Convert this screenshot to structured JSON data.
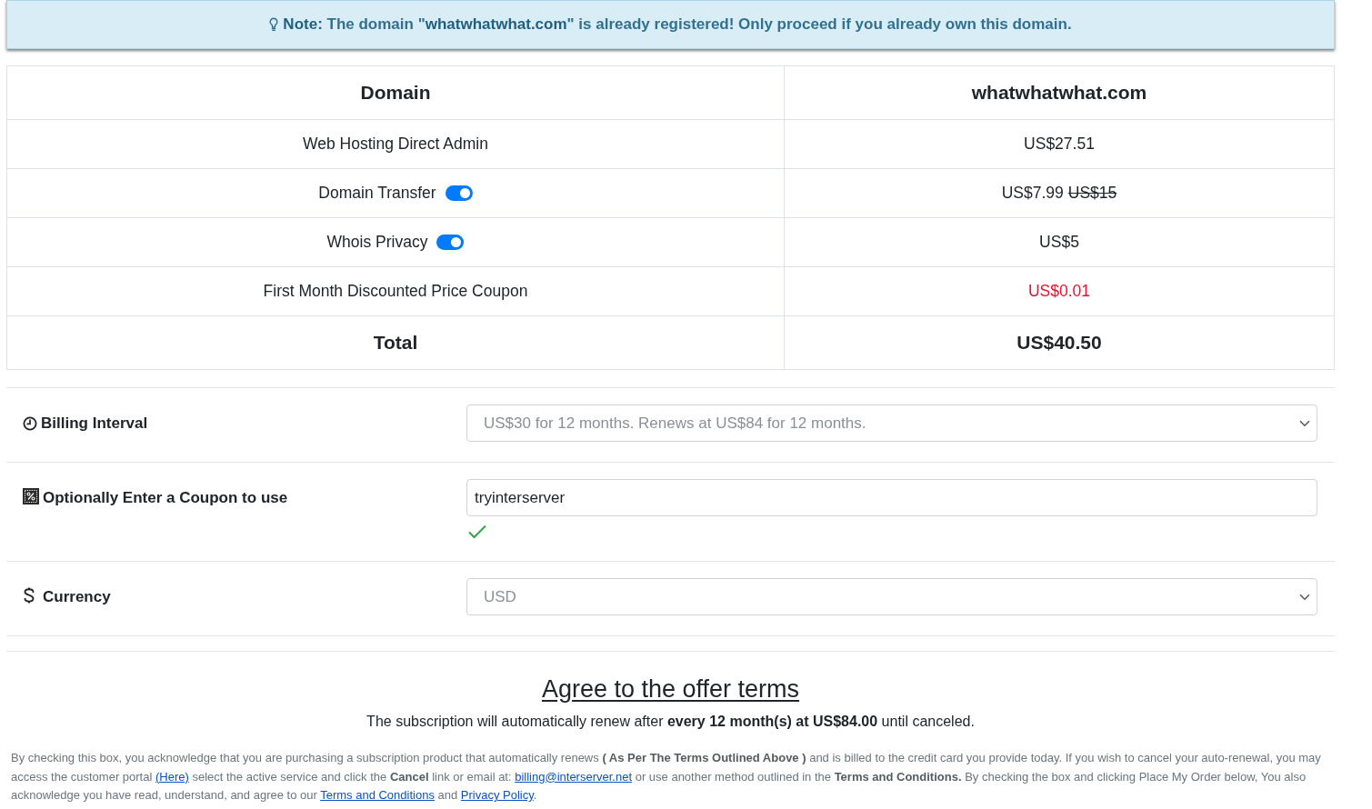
{
  "notice": {
    "text": "**Note:** The domain \"**whatwhatwhat.com**\" is already registered! Only proceed if you already own this domain."
  },
  "order_table": {
    "header": {
      "label": "Domain",
      "value": "whatwhatwhat.com"
    },
    "rows": [
      {
        "kind": "plain",
        "label": "Web Hosting Direct Admin",
        "price": "US$27.51"
      },
      {
        "kind": "toggle",
        "label": "Domain Transfer",
        "on": true,
        "price": "US$7.99",
        "original_price": "US$15"
      },
      {
        "kind": "toggle",
        "label": "Whois Privacy",
        "on": true,
        "price": "US$5"
      },
      {
        "kind": "discount",
        "label": "First Month Discounted Price Coupon",
        "price": "US$0.01"
      }
    ],
    "total": {
      "label": "Total",
      "value": "US$40.50"
    }
  },
  "options": [
    {
      "kind": "select",
      "label": "Billing Interval",
      "value": "US$30 for 12 months. Renews at US$84 for 12 months."
    },
    {
      "kind": "input",
      "label": "Optionally Enter a Coupon to use",
      "value": "tryinterserver",
      "valid": true
    },
    {
      "kind": "select",
      "label": "Currency",
      "value": "USD"
    }
  ],
  "terms": {
    "heading": "Agree to the offer terms",
    "renewal": "The subscription will automatically renew after **every 12 month(s) at US$84.00** until canceled.",
    "legal": [
      {
        "kind": "text",
        "text": "By checking this box, you acknowledge that you are purchasing a subscription product that automatically renews **( As Per The Terms Outlined Above )** and is billed to the credit card you provide today. If you wish to cancel your auto-renewal, you may access the customer portal "
      },
      {
        "kind": "link",
        "text": "(Here)"
      },
      {
        "kind": "text",
        "text": " select the active service and click the **Cancel** link or email at: "
      },
      {
        "kind": "link",
        "text": "billing@interserver.net"
      },
      {
        "kind": "text",
        "text": " or use another method outlined in the **Terms and Conditions.** By checking the box and clicking Place My Order below, You also acknowledge you have read, understand, and agree to our "
      },
      {
        "kind": "link",
        "text": "Terms and Conditions"
      },
      {
        "kind": "text",
        "text": " and "
      },
      {
        "kind": "link",
        "text": "Privacy Policy"
      },
      {
        "kind": "text",
        "text": "."
      }
    ]
  }
}
